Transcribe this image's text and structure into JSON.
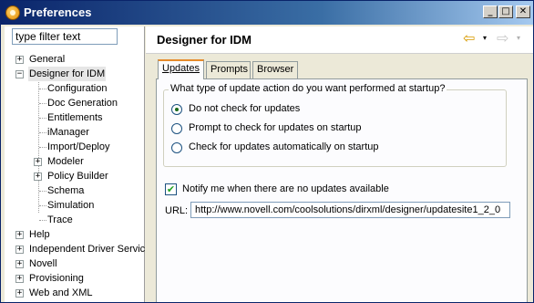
{
  "window": {
    "title": "Preferences",
    "buttons": {
      "minimize": "_",
      "maximize": "□",
      "close": "✕"
    }
  },
  "sidebar": {
    "filter_value": "type filter text",
    "items": [
      {
        "label": "General",
        "expander": "+"
      },
      {
        "label": "Designer for IDM",
        "expander": "−",
        "selected": true
      },
      {
        "label": "Configuration"
      },
      {
        "label": "Doc Generation"
      },
      {
        "label": "Entitlements"
      },
      {
        "label": "iManager"
      },
      {
        "label": "Import/Deploy"
      },
      {
        "label": "Modeler",
        "expander": "+"
      },
      {
        "label": "Policy Builder",
        "expander": "+"
      },
      {
        "label": "Schema"
      },
      {
        "label": "Simulation"
      },
      {
        "label": "Trace"
      },
      {
        "label": "Help",
        "expander": "+"
      },
      {
        "label": "Independent Driver Servic",
        "expander": "+"
      },
      {
        "label": "Novell",
        "expander": "+"
      },
      {
        "label": "Provisioning",
        "expander": "+"
      },
      {
        "label": "Web and XML",
        "expander": "+"
      }
    ]
  },
  "main": {
    "title": "Designer for IDM",
    "nav": {
      "back_icon": "⇦",
      "dropdown_icon": "▾",
      "forward_icon": "⇨"
    },
    "tabs": [
      {
        "label": "Updates",
        "active": true
      },
      {
        "label": "Prompts",
        "active": false
      },
      {
        "label": "Browser",
        "active": false
      }
    ],
    "update_group": {
      "title": "What type of update action do you want performed at startup?",
      "options": [
        {
          "label": "Do not check for updates",
          "checked": true
        },
        {
          "label": "Prompt to check for updates on startup",
          "checked": false
        },
        {
          "label": "Check for updates automatically on startup",
          "checked": false
        }
      ]
    },
    "notify": {
      "label": "Notify me when there are no updates available",
      "checked": true,
      "mark": "✔"
    },
    "url": {
      "label": "URL:",
      "value": "http://www.novell.com/coolsolutions/dirxml/designer/updatesite1_2_0"
    }
  }
}
